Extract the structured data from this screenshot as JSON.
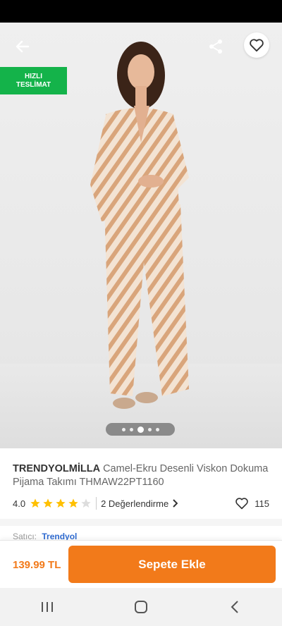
{
  "header": {
    "back_icon": "arrow-left-icon",
    "share_icon": "share-icon",
    "favorite_icon": "heart-outline-icon"
  },
  "badge": {
    "line1": "HIZLI",
    "line2": "TESLİMAT",
    "color": "#14b34a"
  },
  "gallery": {
    "image_subject": "model in pajama set",
    "dots_count": 5,
    "active_index": 2
  },
  "product": {
    "brand": "TRENDYOLMİLLA",
    "name": "Camel-Ekru Desenli Viskon Dokuma Pijama Takımı THMAW22PT1160",
    "rating": "4.0",
    "rating_value": 4,
    "reviews": "2 Değerlendirme",
    "likes": "115",
    "seller_label": "Satıcı:",
    "seller_name": "Trendyol"
  },
  "purchase": {
    "price": "139.99 TL",
    "add_to_cart": "Sepete Ekle",
    "accent_color": "#f27a1a"
  },
  "system_nav": {
    "recent": "recent-apps-icon",
    "home": "home-icon",
    "back": "back-chevron-icon"
  }
}
